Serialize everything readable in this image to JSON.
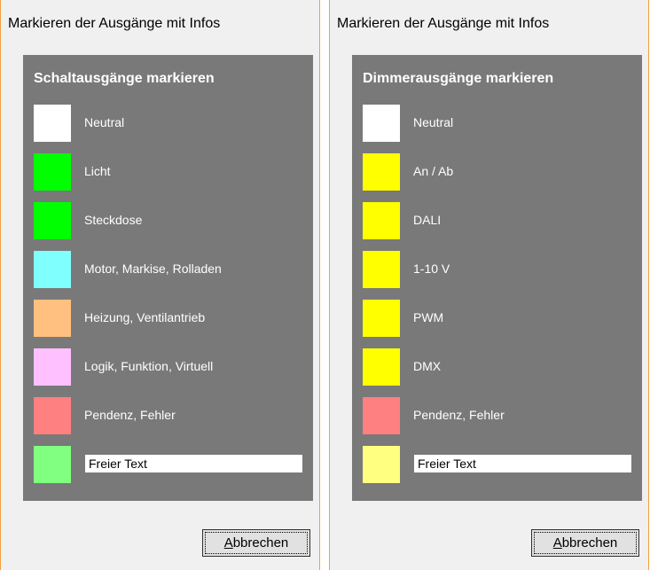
{
  "dialogs": [
    {
      "title": "Markieren der Ausgänge mit Infos",
      "heading": "Schaltausgänge markieren",
      "rows": [
        {
          "label": "Neutral",
          "color": "#ffffff"
        },
        {
          "label": "Licht",
          "color": "#00ff00"
        },
        {
          "label": "Steckdose",
          "color": "#00ff00"
        },
        {
          "label": "Motor, Markise, Rolladen",
          "color": "#80ffff"
        },
        {
          "label": "Heizung, Ventilantrieb",
          "color": "#ffc080"
        },
        {
          "label": "Logik, Funktion, Virtuell",
          "color": "#ffc0ff"
        },
        {
          "label": "Pendenz, Fehler",
          "color": "#ff8080"
        }
      ],
      "free_text": {
        "value": "Freier Text",
        "color": "#80ff80"
      },
      "cancel_label": "Abbrechen"
    },
    {
      "title": "Markieren der Ausgänge mit Infos",
      "heading": "Dimmerausgänge markieren",
      "rows": [
        {
          "label": "Neutral",
          "color": "#ffffff"
        },
        {
          "label": "An / Ab",
          "color": "#ffff00"
        },
        {
          "label": "DALI",
          "color": "#ffff00"
        },
        {
          "label": "1-10 V",
          "color": "#ffff00"
        },
        {
          "label": "PWM",
          "color": "#ffff00"
        },
        {
          "label": "DMX",
          "color": "#ffff00"
        },
        {
          "label": "Pendenz, Fehler",
          "color": "#ff8080"
        }
      ],
      "free_text": {
        "value": "Freier Text",
        "color": "#ffff80"
      },
      "cancel_label": "Abbrechen"
    }
  ]
}
